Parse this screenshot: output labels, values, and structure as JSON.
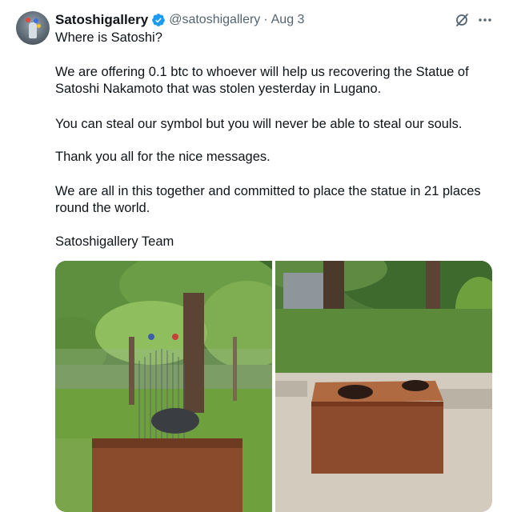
{
  "tweet": {
    "display_name": "Satoshigallery",
    "handle": "@satoshigallery",
    "separator": "·",
    "date": "Aug 3",
    "lines": [
      "Where is Satoshi?",
      "We are offering 0.1 btc to whoever will help us recovering the Statue of",
      "Satoshi Nakamoto that was stolen yesterday in Lugano.",
      "You can steal our symbol but you will never be able to steal our souls.",
      "Thank you all for the nice messages.",
      "We are all in this together and committed to place the statue in 21 places",
      "round the world.",
      "Satoshigallery Team"
    ]
  },
  "icons": {
    "verified": "verified-badge-icon",
    "grok": "grok-icon",
    "more": "more-options-icon"
  },
  "colors": {
    "verified_blue": "#1d9bf0",
    "secondary_text": "#536471",
    "primary_text": "#0f1419"
  }
}
